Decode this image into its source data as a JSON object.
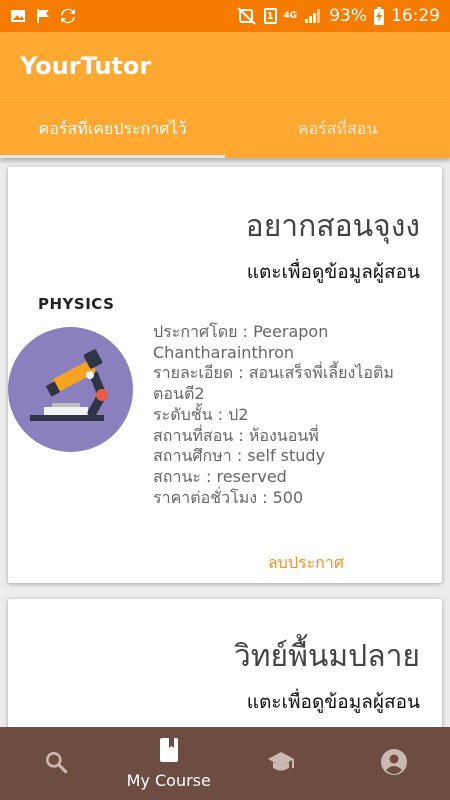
{
  "status_bar": {
    "battery": "93%",
    "time": "16:29",
    "network": "4G",
    "sim_badge": "1",
    "icons": [
      "photo-icon",
      "flag-icon",
      "sync-icon",
      "mute-icon",
      "sim-icon",
      "signal-icon",
      "battery-icon"
    ]
  },
  "app": {
    "title": "YourTutor"
  },
  "tabs": [
    {
      "label": "คอร์สที่เคยประกาศไว้",
      "active": true
    },
    {
      "label": "คอร์สที่สอน",
      "active": false
    }
  ],
  "courses": [
    {
      "title": "อยากสอนจุงง",
      "tap_hint": "แตะเพื่อดูข้อมูลผู้สอน",
      "subject_label": "PHYSICS",
      "details": [
        "ประกาศโดย : Peerapon",
        "Chantharainthron",
        " รายละเอียด : สอนเสร็จพี่เลี้ยงไอติม",
        "ตอนตี2",
        "ระดับชั้น : ป2",
        " สถานที่สอน : ห้องนอนพี่",
        " สถานศึกษา : self study",
        "สถานะ : reserved",
        " ราคาต่อชั่วโมง : 500"
      ],
      "delete_label": "ลบประกาศ"
    },
    {
      "title": "วิทย์พื้นมปลาย",
      "tap_hint": "แตะเพื่อดูข้อมูลผู้สอน"
    }
  ],
  "bottom_nav": {
    "items": [
      {
        "icon": "search-icon",
        "label": ""
      },
      {
        "icon": "book-icon",
        "label": "My Course",
        "active": true
      },
      {
        "icon": "school-icon",
        "label": ""
      },
      {
        "icon": "account-icon",
        "label": ""
      }
    ]
  },
  "colors": {
    "status_bar": "#f57c00",
    "app_bar": "#ffa832",
    "bottom_nav": "#6d4c41",
    "accent_link": "#f0932b"
  }
}
